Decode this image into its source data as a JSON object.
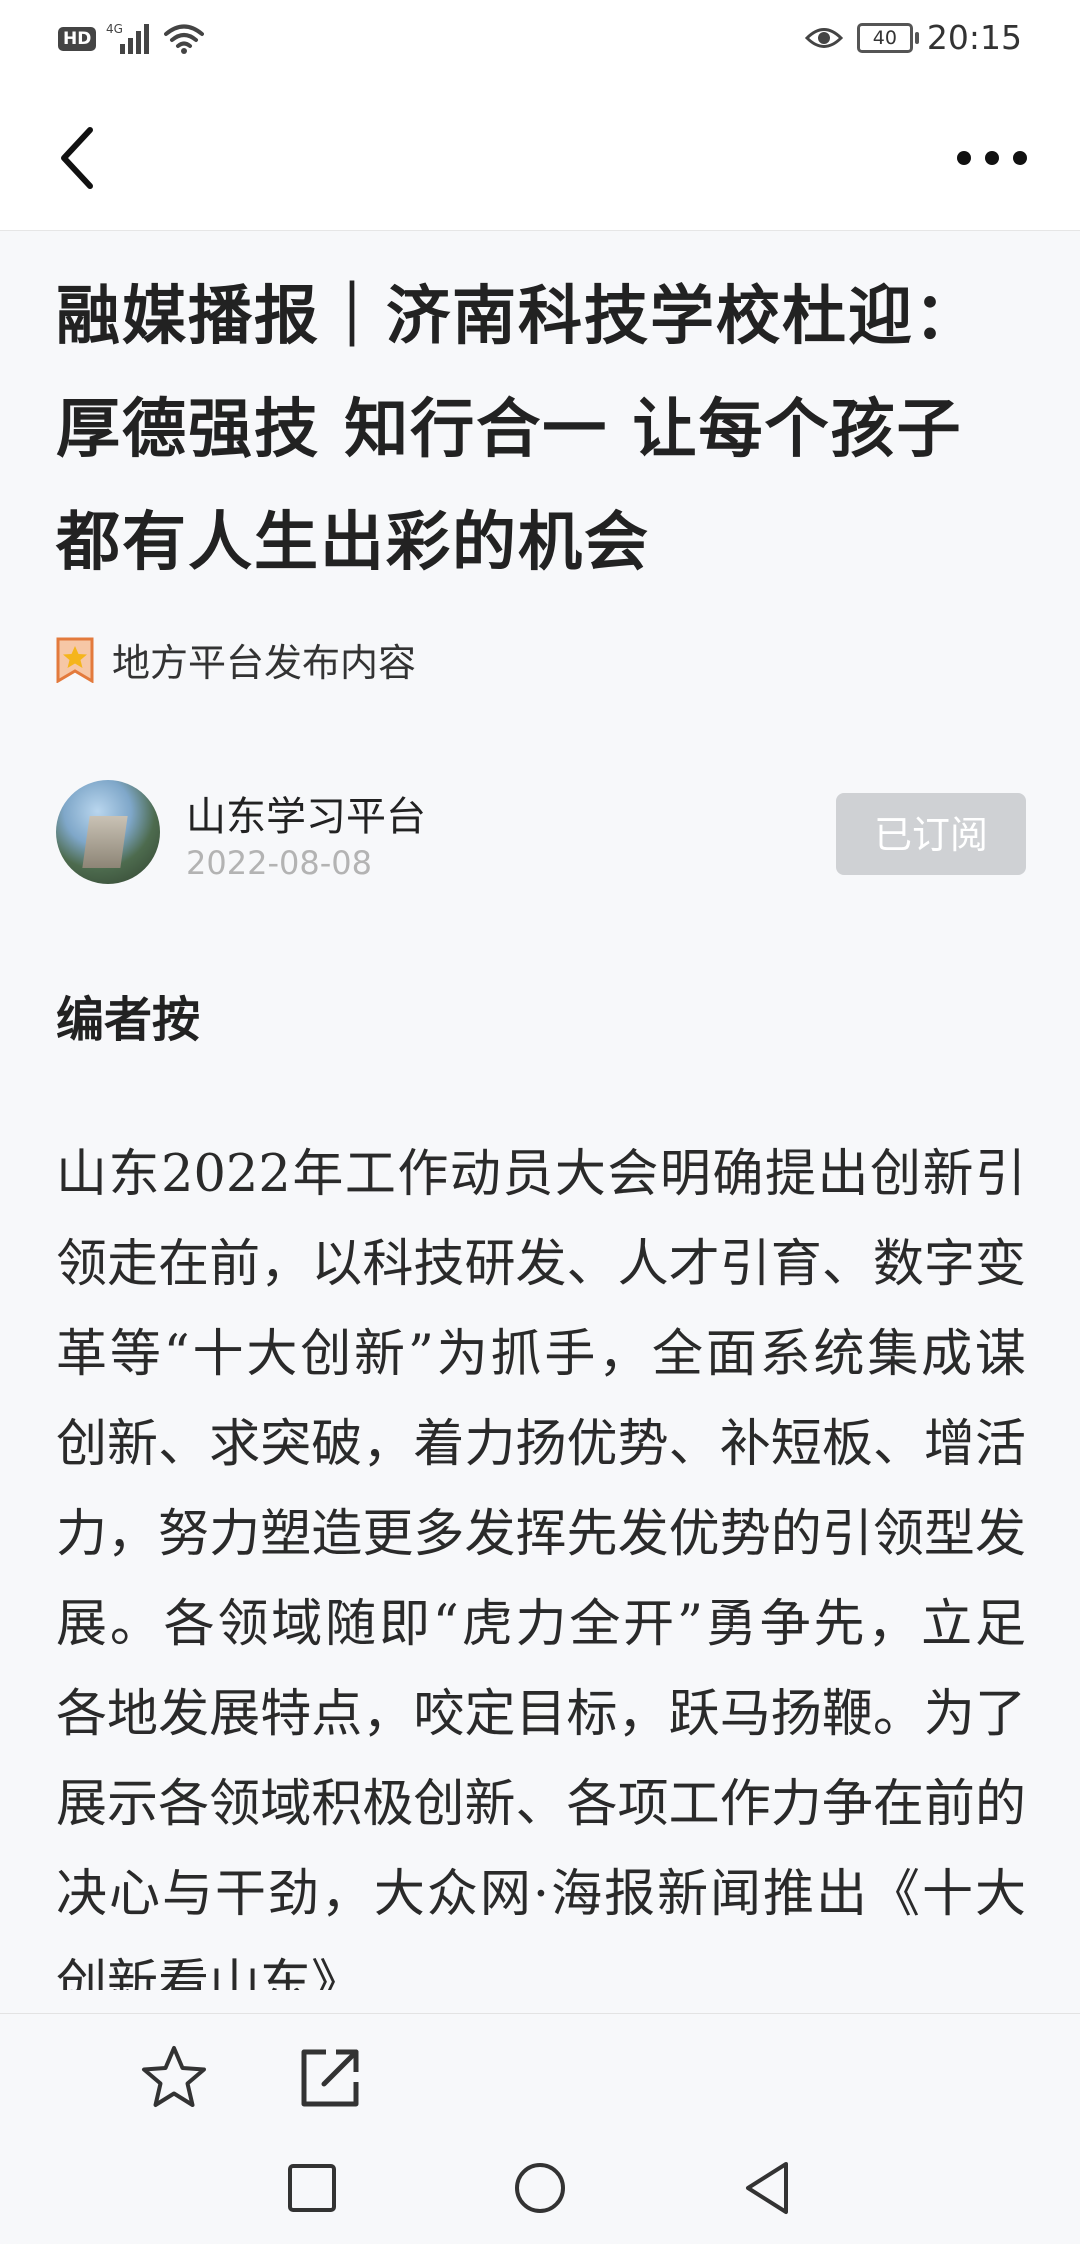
{
  "status_bar": {
    "network": "HD",
    "signal_label": "4G",
    "battery": "40",
    "time": "20:15"
  },
  "article": {
    "title": "融媒播报｜济南科技学校杜迎：厚德强技 知行合一 让每个孩子都有人生出彩的机会",
    "source_label": "地方平台发布内容",
    "author": "山东学习平台",
    "date": "2022-08-08",
    "subscribe_label": "已订阅",
    "editor_heading": "编者按",
    "body": "山东2022年工作动员大会明确提出创新引领走在前，以科技研发、人才引育、数字变革等“十大创新”为抓手，全面系统集成谋创新、求突破，着力扬优势、补短板、增活力，努力塑造更多发挥先发优势的引领型发展。各领域随即“虎力全开”勇争先，立足各地发展特点，咬定目标，跃马扬鞭。为了展示各领域积极创新、各项工作力争在前的决心与干劲，大众网·海报新闻推出《十大创新看山东》"
  },
  "icons": {
    "back": "back-arrow-icon",
    "more": "more-dots-icon",
    "star": "star-icon",
    "share": "share-icon",
    "recent": "square-icon",
    "home": "circle-icon",
    "nav_back": "triangle-back-icon"
  }
}
